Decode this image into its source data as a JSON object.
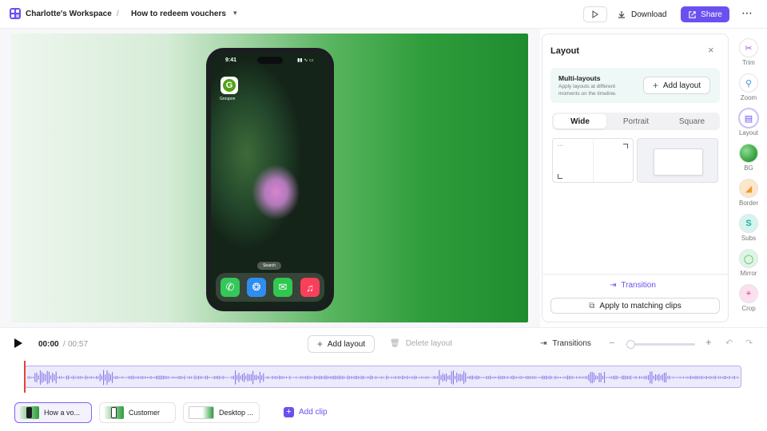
{
  "header": {
    "workspace": "Charlotte's Workspace",
    "separator": "/",
    "project_title": "How to redeem vouchers",
    "download_label": "Download",
    "share_label": "Share"
  },
  "phone": {
    "time": "9:41",
    "app_label": "Groupon",
    "app_letter": "G",
    "search_pill": "Search"
  },
  "panel": {
    "title": "Layout",
    "multi_title": "Multi-layouts",
    "multi_desc": "Apply layouts at different moments on the timeline.",
    "add_layout": "Add layout",
    "tabs": [
      "Wide",
      "Portrait",
      "Square"
    ],
    "active_tab": "Wide",
    "transition": "Transition",
    "apply_matching": "Apply to matching clips"
  },
  "tools": [
    {
      "label": "Trim",
      "icon": "scissors-icon",
      "color": "#a64fe0"
    },
    {
      "label": "Zoom",
      "icon": "zoom-icon",
      "color": "#3b8fd9"
    },
    {
      "label": "Layout",
      "icon": "layout-icon",
      "color": "#6b50f0"
    },
    {
      "label": "BG",
      "icon": "background-icon",
      "color": "#2f9d3b"
    },
    {
      "label": "Border",
      "icon": "border-icon",
      "color": "#e89a3b"
    },
    {
      "label": "Subs",
      "icon": "subtitles-icon",
      "color": "#1fae9b"
    },
    {
      "label": "Mirror",
      "icon": "mirror-icon",
      "color": "#3db55a"
    },
    {
      "label": "Crop",
      "icon": "crop-icon",
      "color": "#d9408f"
    }
  ],
  "controls": {
    "time_current": "00:00",
    "time_sep": "/",
    "time_total": "00:57",
    "add_layout": "Add layout",
    "delete_layout": "Delete layout",
    "transitions": "Transitions"
  },
  "clips": [
    {
      "label": "How a vo...",
      "active": true
    },
    {
      "label": "Customer",
      "active": false
    },
    {
      "label": "Desktop ...",
      "active": false
    }
  ],
  "add_clip": "Add clip",
  "colors": {
    "accent": "#6b50f0",
    "playhead": "#e5413a"
  }
}
